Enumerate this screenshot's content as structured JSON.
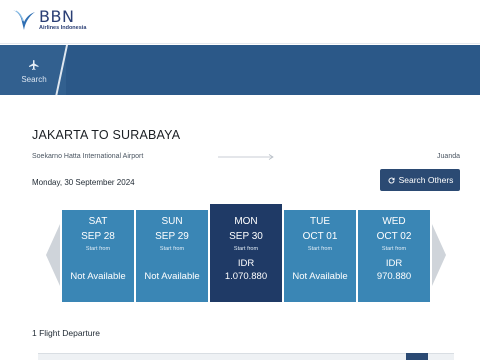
{
  "brand": {
    "name": "BBN",
    "subtitle": "Airlines Indonesia",
    "logo_icon": "bird-logo-icon",
    "color": "#2b3f75"
  },
  "nav": {
    "tabs": [
      {
        "label": "Search",
        "icon": "airplane-icon",
        "active": true
      }
    ],
    "color": "#2f5d8c"
  },
  "route": {
    "title": "JAKARTA TO SURABAYA",
    "origin": "Soekarno Hatta International Airport",
    "destination": "Juanda",
    "date": "Monday, 30 September 2024"
  },
  "search_others": {
    "label": "Search Others",
    "icon": "refresh-icon"
  },
  "days": [
    {
      "day": "SAT",
      "date": "SEP 28",
      "start_from": "Start from",
      "status": "Not Available",
      "active": false
    },
    {
      "day": "SUN",
      "date": "SEP 29",
      "start_from": "Start from",
      "status": "Not Available",
      "active": false
    },
    {
      "day": "MON",
      "date": "SEP 30",
      "start_from": "Start from",
      "currency": "IDR",
      "price": "1.070.880",
      "active": true
    },
    {
      "day": "TUE",
      "date": "OCT 01",
      "start_from": "Start from",
      "status": "Not Available",
      "active": false
    },
    {
      "day": "WED",
      "date": "OCT 02",
      "start_from": "Start from",
      "currency": "IDR",
      "price": "970.880",
      "active": false
    }
  ],
  "colors": {
    "day_default": "#3a86b5",
    "day_active": "#1f3a66",
    "button": "#2b4a73"
  },
  "results": {
    "count_label": "1 Flight Departure"
  }
}
